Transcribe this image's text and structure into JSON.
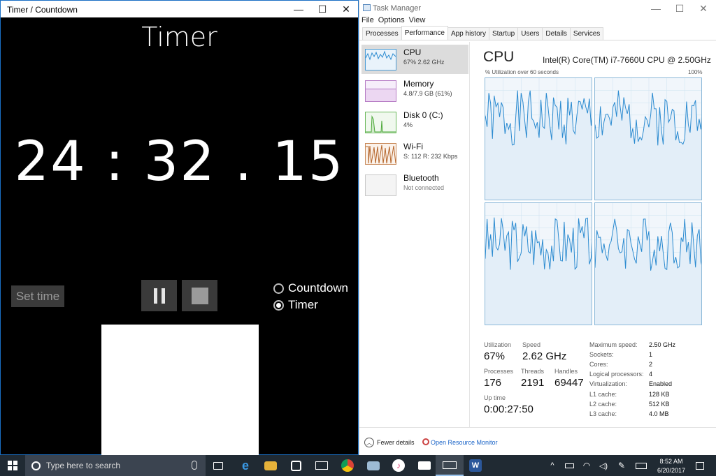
{
  "timer_window": {
    "title": "Timer / Countdown",
    "heading": "Timer",
    "display": "24 : 32 . 15",
    "set_time_label": "Set time",
    "radio_countdown": "Countdown",
    "radio_timer": "Timer",
    "selected_mode": "Timer"
  },
  "task_manager": {
    "title": "Task Manager",
    "menu": [
      "File",
      "Options",
      "View"
    ],
    "tabs": [
      "Processes",
      "Performance",
      "App history",
      "Startup",
      "Users",
      "Details",
      "Services"
    ],
    "active_tab": "Performance",
    "sidebar": [
      {
        "name": "CPU",
        "sub": "67% 2.62 GHz",
        "color": "#1f7fc4"
      },
      {
        "name": "Memory",
        "sub": "4.8/7.9 GB (61%)",
        "color": "#a53fb7"
      },
      {
        "name": "Disk 0 (C:)",
        "sub": "4%",
        "color": "#4da83a"
      },
      {
        "name": "Wi-Fi",
        "sub": "S: 112  R: 232 Kbps",
        "color": "#b5652a"
      },
      {
        "name": "Bluetooth",
        "sub": "Not connected",
        "color": "#9a9a9a"
      }
    ],
    "cpu": {
      "heading": "CPU",
      "model": "Intel(R) Core(TM) i7-7660U CPU @ 2.50GHz",
      "util_label": "% Utilization over 60 seconds",
      "util_max": "100%",
      "utilization_label": "Utilization",
      "utilization": "67%",
      "speed_label": "Speed",
      "speed": "2.62 GHz",
      "processes_label": "Processes",
      "processes": "176",
      "threads_label": "Threads",
      "threads": "2191",
      "handles_label": "Handles",
      "handles": "69447",
      "uptime_label": "Up time",
      "uptime": "0:00:27:50",
      "details": [
        {
          "k": "Maximum speed:",
          "v": "2.50 GHz"
        },
        {
          "k": "Sockets:",
          "v": "1"
        },
        {
          "k": "Cores:",
          "v": "2"
        },
        {
          "k": "Logical processors:",
          "v": "4"
        },
        {
          "k": "Virtualization:",
          "v": "Enabled"
        },
        {
          "k": "L1 cache:",
          "v": "128 KB"
        },
        {
          "k": "L2 cache:",
          "v": "512 KB"
        },
        {
          "k": "L3 cache:",
          "v": "4.0 MB"
        }
      ]
    },
    "footer": {
      "fewer_details": "Fewer details",
      "open_resource_monitor": "Open Resource Monitor"
    }
  },
  "taskbar": {
    "search_placeholder": "Type here to search",
    "clock_time": "8:52 AM",
    "clock_date": "6/20/2017"
  },
  "colors": {
    "graph_line": "#2a8ad0",
    "accent": "#1a6fc4"
  }
}
